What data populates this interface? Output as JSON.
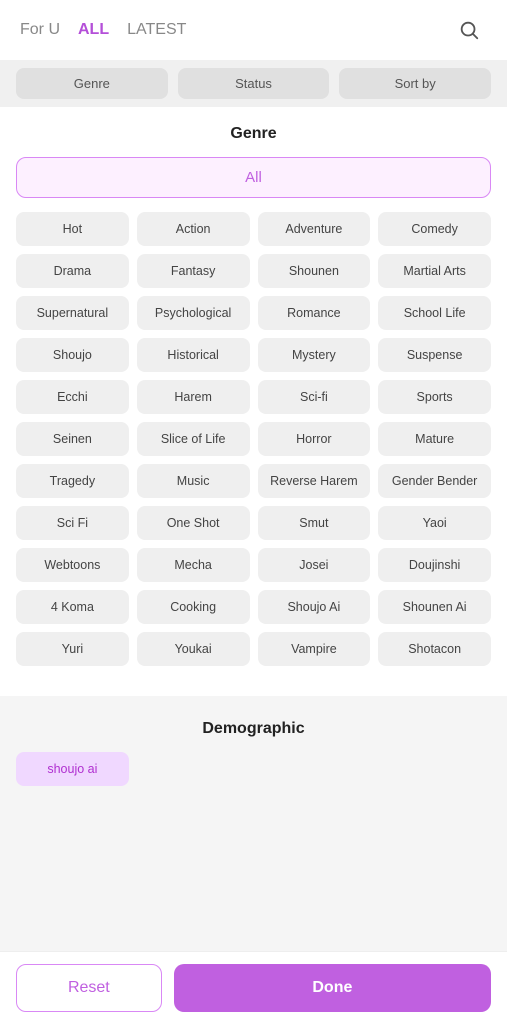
{
  "nav": {
    "items": [
      {
        "id": "for-u",
        "label": "For U",
        "active": false
      },
      {
        "id": "all",
        "label": "ALL",
        "active": true
      },
      {
        "id": "latest",
        "label": "LATEST",
        "active": false
      }
    ]
  },
  "filters": {
    "genre_label": "Genre",
    "status_label": "Status",
    "sortby_label": "Sort by"
  },
  "genre_panel": {
    "title": "Genre",
    "all_label": "All",
    "genres": [
      "Hot",
      "Action",
      "Adventure",
      "Comedy",
      "Drama",
      "Fantasy",
      "Shounen",
      "Martial Arts",
      "Supernatural",
      "Psychological",
      "Romance",
      "School Life",
      "Shoujo",
      "Historical",
      "Mystery",
      "Suspense",
      "Ecchi",
      "Harem",
      "Sci-fi",
      "Sports",
      "Seinen",
      "Slice of Life",
      "Horror",
      "Mature",
      "Tragedy",
      "Music",
      "Reverse Harem",
      "Gender Bender",
      "Sci Fi",
      "One Shot",
      "Smut",
      "Yaoi",
      "Webtoons",
      "Mecha",
      "Josei",
      "Doujinshi",
      "4 Koma",
      "Cooking",
      "Shoujo Ai",
      "Shounen Ai",
      "Yuri",
      "Youkai",
      "Vampire",
      "Shotacon"
    ]
  },
  "demographic_panel": {
    "title": "Demographic",
    "items": [
      "shoujo ai"
    ]
  },
  "bottom_bar": {
    "reset_label": "Reset",
    "done_label": "Done"
  },
  "icons": {
    "search": "🔍"
  }
}
